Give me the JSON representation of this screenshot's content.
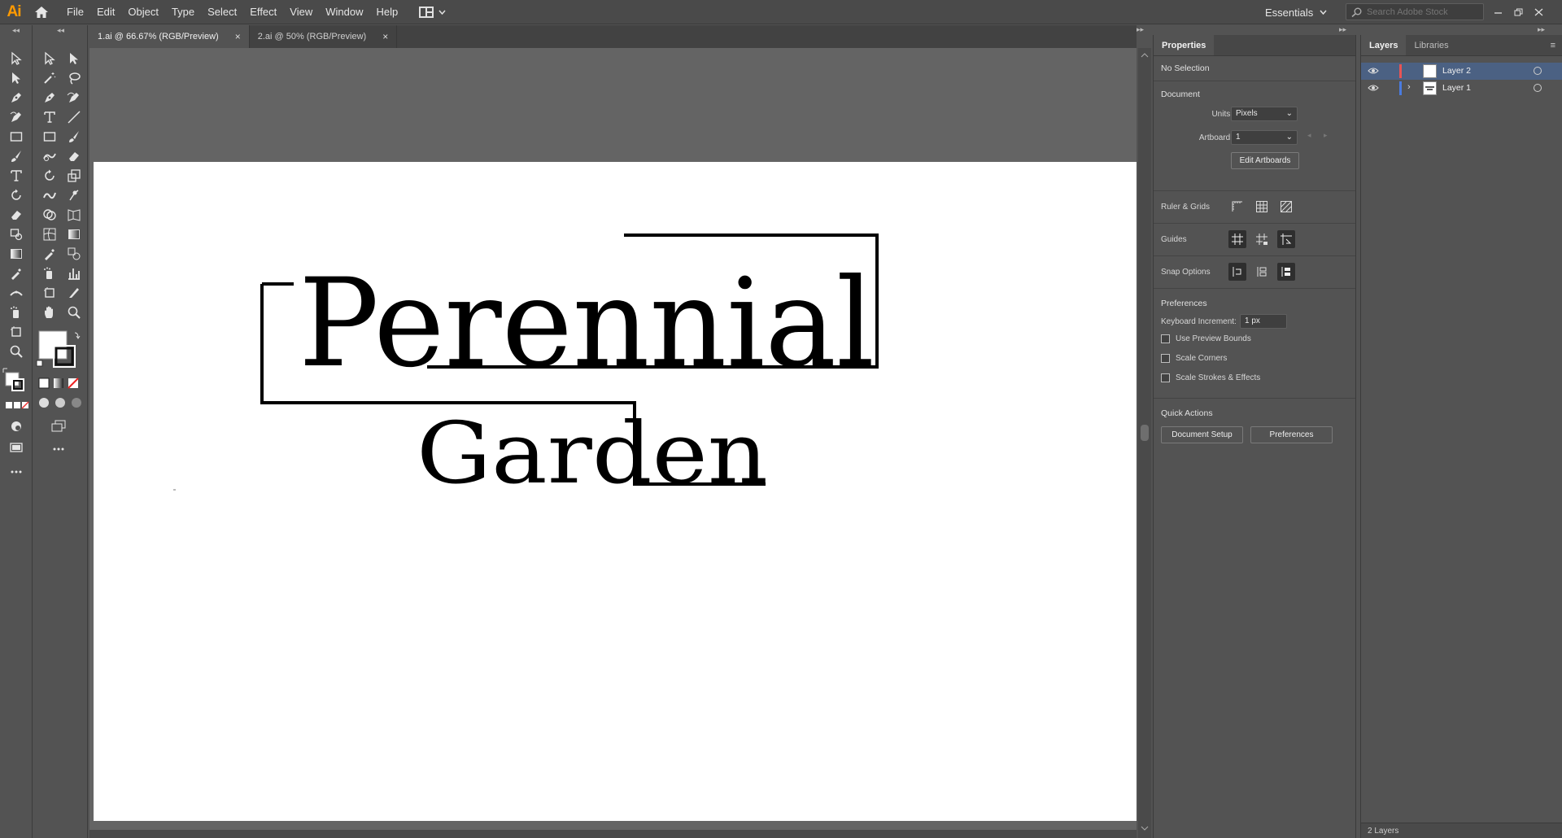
{
  "app": {
    "logo": "Ai",
    "menus": [
      "File",
      "Edit",
      "Object",
      "Type",
      "Select",
      "Effect",
      "View",
      "Window",
      "Help"
    ],
    "workspace": "Essentials",
    "stock_search_placeholder": "Search Adobe Stock"
  },
  "tabs": [
    {
      "label": "1.ai @ 66.67% (RGB/Preview)",
      "active": true,
      "close": "×"
    },
    {
      "label": "2.ai @ 50% (RGB/Preview)",
      "active": false,
      "close": "×"
    }
  ],
  "artwork": {
    "title_word": "Perennial",
    "subtitle_word": "Garden"
  },
  "properties": {
    "tabs": [
      "Properties"
    ],
    "selection": "No Selection",
    "document_heading": "Document",
    "units_label": "Units:",
    "units_value": "Pixels",
    "artboard_label": "Artboard:",
    "artboard_value": "1",
    "edit_artboards": "Edit Artboards",
    "ruler_grids": "Ruler & Grids",
    "guides": "Guides",
    "snap_options": "Snap Options",
    "preferences_heading": "Preferences",
    "keyboard_increment_label": "Keyboard Increment:",
    "keyboard_increment_value": "1 px",
    "use_preview_bounds": "Use Preview Bounds",
    "scale_corners": "Scale Corners",
    "scale_strokes": "Scale Strokes & Effects",
    "quick_actions": "Quick Actions",
    "document_setup": "Document Setup",
    "preferences_btn": "Preferences"
  },
  "layers": {
    "tabs": [
      "Layers",
      "Libraries"
    ],
    "items": [
      {
        "name": "Layer 2",
        "color": "#e85454",
        "selected": true
      },
      {
        "name": "Layer 1",
        "color": "#4a7be0",
        "selected": false
      }
    ],
    "footer": "2 Layers"
  },
  "colors": {
    "accent_orange": "#ff9a00",
    "selected_row": "#4b6183"
  }
}
